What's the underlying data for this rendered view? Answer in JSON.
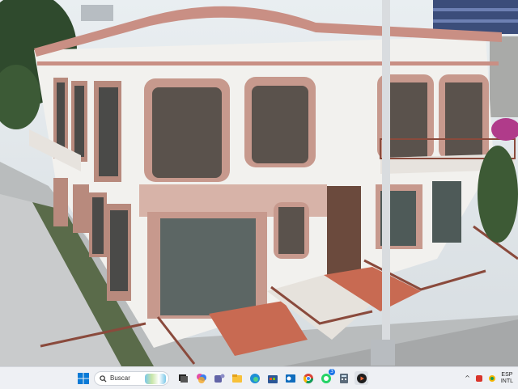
{
  "taskbar": {
    "search_label": "Buscar",
    "icons": [
      {
        "name": "windows-start-icon",
        "color": "#0078d4"
      },
      {
        "name": "search-icon"
      },
      {
        "name": "task-view-icon"
      },
      {
        "name": "copilot-icon"
      },
      {
        "name": "teams-icon"
      },
      {
        "name": "file-explorer-icon"
      },
      {
        "name": "edge-icon"
      },
      {
        "name": "store-icon"
      },
      {
        "name": "outlook-icon"
      },
      {
        "name": "chrome-icon"
      },
      {
        "name": "whatsapp-icon",
        "badge": "3"
      },
      {
        "name": "calculator-icon"
      },
      {
        "name": "media-player-icon"
      }
    ],
    "whatsapp_badge": "3",
    "tray": {
      "lang_line1": "ESP",
      "lang_line2": "INTL"
    }
  },
  "wallpaper": {
    "description_icon": "building-photo"
  }
}
